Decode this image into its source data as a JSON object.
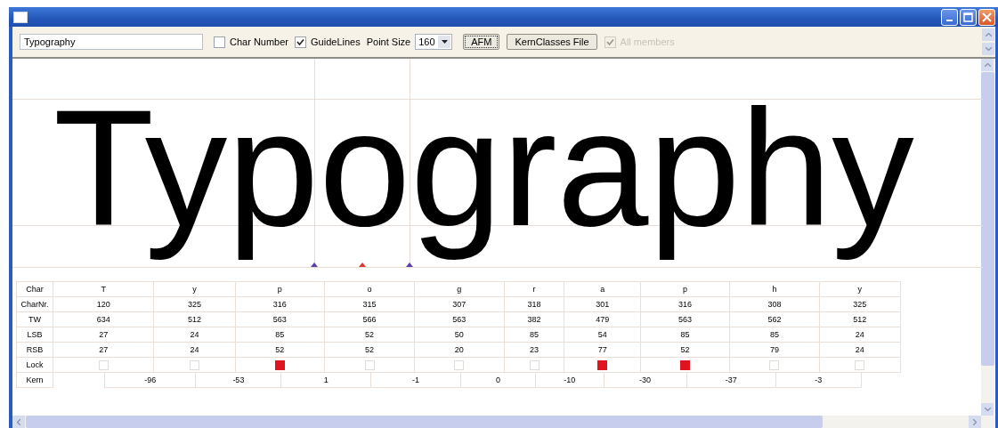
{
  "toolbar": {
    "text_field": {
      "value": "Typography"
    },
    "char_number": {
      "label": "Char Number",
      "checked": false
    },
    "guidelines": {
      "label": "GuideLines",
      "checked": true
    },
    "point_size": {
      "label": "Point Size",
      "value": "160"
    },
    "afm_button": {
      "label": "AFM",
      "focused": true
    },
    "kern_classes_button": {
      "label": "KernClasses File"
    },
    "all_members": {
      "label": "All members",
      "checked": true,
      "disabled": true
    }
  },
  "sample_text": "Typography",
  "markers": [
    {
      "color": "#5a3ea6"
    },
    {
      "color": "#e2362a"
    },
    {
      "color": "#5a3ea6"
    }
  ],
  "glyph_table": {
    "row_labels": [
      "Char",
      "CharNr.",
      "TW",
      "LSB",
      "RSB",
      "Lock"
    ],
    "columns": [
      {
        "char": "T",
        "char_nr": "120",
        "tw": "634",
        "lsb": "27",
        "rsb": "27",
        "locked": false
      },
      {
        "char": "y",
        "char_nr": "325",
        "tw": "512",
        "lsb": "24",
        "rsb": "24",
        "locked": false
      },
      {
        "char": "p",
        "char_nr": "316",
        "tw": "563",
        "lsb": "85",
        "rsb": "52",
        "locked": true
      },
      {
        "char": "o",
        "char_nr": "315",
        "tw": "566",
        "lsb": "52",
        "rsb": "52",
        "locked": false
      },
      {
        "char": "g",
        "char_nr": "307",
        "tw": "563",
        "lsb": "50",
        "rsb": "20",
        "locked": false
      },
      {
        "char": "r",
        "char_nr": "318",
        "tw": "382",
        "lsb": "85",
        "rsb": "23",
        "locked": false
      },
      {
        "char": "a",
        "char_nr": "301",
        "tw": "479",
        "lsb": "54",
        "rsb": "77",
        "locked": true
      },
      {
        "char": "p",
        "char_nr": "316",
        "tw": "563",
        "lsb": "85",
        "rsb": "52",
        "locked": true
      },
      {
        "char": "h",
        "char_nr": "308",
        "tw": "562",
        "lsb": "85",
        "rsb": "79",
        "locked": false
      },
      {
        "char": "y",
        "char_nr": "325",
        "tw": "512",
        "lsb": "24",
        "rsb": "24",
        "locked": false
      }
    ],
    "kern": {
      "label": "Kern",
      "values": [
        "-96",
        "-53",
        "1",
        "-1",
        "0",
        "-10",
        "-30",
        "-37",
        "-3"
      ]
    }
  }
}
